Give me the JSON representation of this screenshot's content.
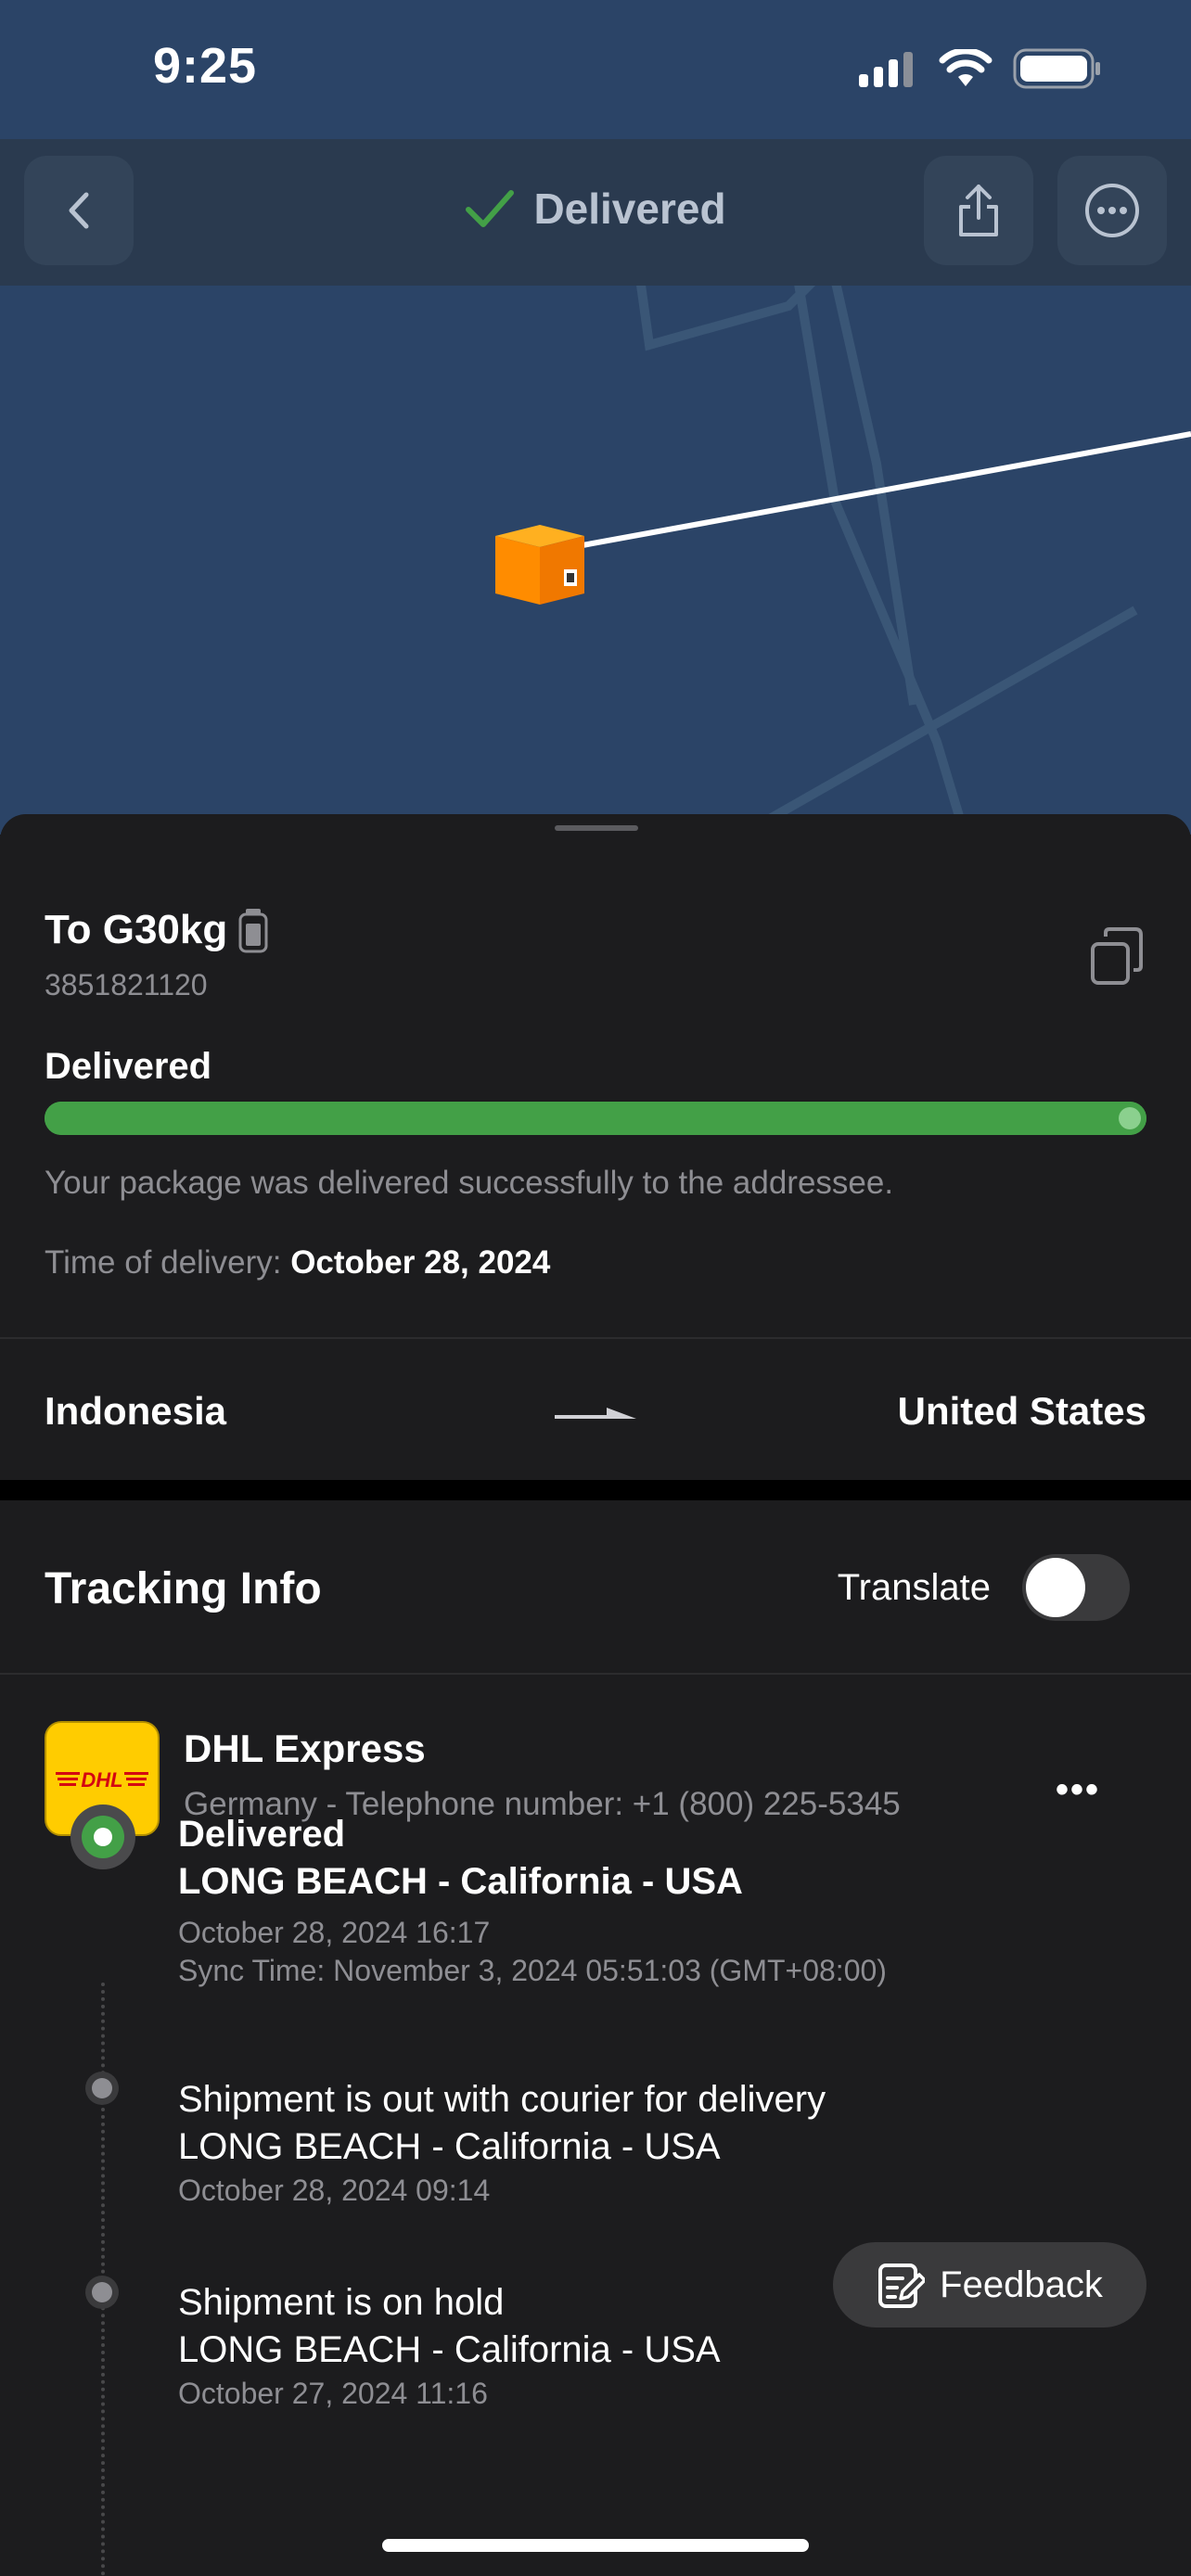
{
  "status_bar": {
    "time": "9:25"
  },
  "nav": {
    "title": "Delivered"
  },
  "package": {
    "name": "To G30kg",
    "number": "3851821120",
    "status": "Delivered",
    "progress_percent": 100,
    "description": "Your package was delivered successfully to the addressee.",
    "delivery_time_label": "Time of delivery:",
    "delivery_time_value": "October 28, 2024"
  },
  "route": {
    "from": "Indonesia",
    "to": "United States"
  },
  "tracking": {
    "heading": "Tracking Info",
    "translate_label": "Translate",
    "translate_on": false
  },
  "carrier": {
    "logo_text": "DHL",
    "name": "DHL Express",
    "info": "Germany - Telephone number: +1 (800) 225-5345",
    "more_label": "•••"
  },
  "events": [
    {
      "status": "Delivered",
      "location": "LONG BEACH - California - USA",
      "time": "October 28, 2024 16:17",
      "sync": "Sync Time: November 3, 2024 05:51:03 (GMT+08:00)"
    },
    {
      "status": "Shipment is out with courier for delivery",
      "location": "LONG BEACH - California - USA",
      "time": "October 28, 2024 09:14"
    },
    {
      "status": "Shipment is on hold",
      "location": "LONG BEACH - California - USA",
      "time": "October 27, 2024 11:16"
    }
  ],
  "feedback": {
    "label": "Feedback"
  },
  "colors": {
    "accent_green": "#43a047",
    "map_bg": "#2b4467",
    "dhl_yellow": "#ffcc00",
    "dhl_red": "#d40511"
  },
  "icons": [
    "back-chevron-icon",
    "checkmark-icon",
    "share-icon",
    "more-options-icon",
    "battery-icon",
    "copy-icon",
    "route-arrow-icon",
    "feedback-edit-icon"
  ]
}
